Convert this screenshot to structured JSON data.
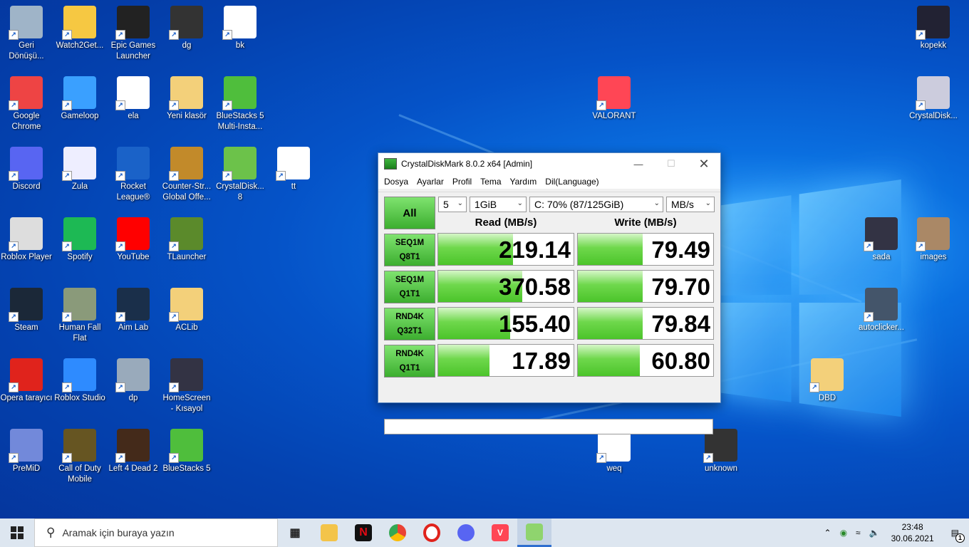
{
  "desktop_icons": [
    {
      "label": "Geri Dönüşü...",
      "color": "#9fb4c8"
    },
    {
      "label": "Watch2Get...",
      "color": "#f6c842"
    },
    {
      "label": "Epic Games Launcher",
      "color": "#222"
    },
    {
      "label": "dg",
      "color": "#333"
    },
    {
      "label": "bk",
      "color": "#fff"
    },
    {
      "label": "Google Chrome",
      "color": "#e44"
    },
    {
      "label": "Gameloop",
      "color": "#3aa0ff"
    },
    {
      "label": "ela",
      "color": "#fff"
    },
    {
      "label": "Yeni klasör",
      "color": "#f3d07a"
    },
    {
      "label": "BlueStacks 5 Multi-Insta...",
      "color": "#4fbe3c"
    },
    {
      "label": "Discord",
      "color": "#5865f2"
    },
    {
      "label": "Zula",
      "color": "#eef"
    },
    {
      "label": "Rocket League®",
      "color": "#1a62c8"
    },
    {
      "label": "Counter-Str... Global Offe...",
      "color": "#c28a2a"
    },
    {
      "label": "CrystalDisk... 8",
      "color": "#6cc24a"
    },
    {
      "label": "tt",
      "color": "#fff"
    },
    {
      "label": "Roblox Player",
      "color": "#ddd"
    },
    {
      "label": "Spotify",
      "color": "#1db954"
    },
    {
      "label": "YouTube",
      "color": "#f00"
    },
    {
      "label": "TLauncher",
      "color": "#5b8a2b"
    },
    {
      "label": "Steam",
      "color": "#1b2838"
    },
    {
      "label": "Human Fall Flat",
      "color": "#8a9a7a"
    },
    {
      "label": "Aim Lab",
      "color": "#1a2f4a"
    },
    {
      "label": "ACLib",
      "color": "#f3d07a"
    },
    {
      "label": "Opera tarayıcı",
      "color": "#e0231c"
    },
    {
      "label": "Roblox Studio",
      "color": "#2e8bff"
    },
    {
      "label": "dp",
      "color": "#9ab"
    },
    {
      "label": "HomeScreen - Kısayol",
      "color": "#334"
    },
    {
      "label": "PreMiD",
      "color": "#7289da"
    },
    {
      "label": "Call of Duty Mobile",
      "color": "#665522"
    },
    {
      "label": "Left 4 Dead 2",
      "color": "#442a1a"
    },
    {
      "label": "BlueStacks 5",
      "color": "#4fbe3c"
    },
    {
      "label": "VALORANT",
      "color": "#ff4655"
    },
    {
      "label": "weq",
      "color": "#fff"
    },
    {
      "label": "unknown",
      "color": "#333"
    },
    {
      "label": "kopekk",
      "color": "#223"
    },
    {
      "label": "CrystalDisk...",
      "color": "#ccd"
    },
    {
      "label": "sada",
      "color": "#334"
    },
    {
      "label": "images",
      "color": "#aa8866"
    },
    {
      "label": "autoclicker...",
      "color": "#44556a"
    },
    {
      "label": "DBD",
      "color": "#f3d07a"
    }
  ],
  "cdm": {
    "title": "CrystalDiskMark 8.0.2 x64 [Admin]",
    "menu": [
      "Dosya",
      "Ayarlar",
      "Profil",
      "Tema",
      "Yardım",
      "Dil(Language)"
    ],
    "all_label": "All",
    "count": "5",
    "size": "1GiB",
    "drive": "C: 70% (87/125GiB)",
    "unit": "MB/s",
    "read_header": "Read (MB/s)",
    "write_header": "Write (MB/s)",
    "rows": [
      {
        "l1": "SEQ1M",
        "l2": "Q8T1",
        "read": "219.14",
        "write": "79.49",
        "read_fill": 0.55,
        "write_fill": 0.48
      },
      {
        "l1": "SEQ1M",
        "l2": "Q1T1",
        "read": "370.58",
        "write": "79.70",
        "read_fill": 0.62,
        "write_fill": 0.48
      },
      {
        "l1": "RND4K",
        "l2": "Q32T1",
        "read": "155.40",
        "write": "79.84",
        "read_fill": 0.53,
        "write_fill": 0.48
      },
      {
        "l1": "RND4K",
        "l2": "Q1T1",
        "read": "17.89",
        "write": "60.80",
        "read_fill": 0.38,
        "write_fill": 0.46
      }
    ]
  },
  "taskbar": {
    "search_placeholder": "Aramak için buraya yazın",
    "time": "23:48",
    "date": "30.06.2021",
    "notification_count": "1"
  }
}
